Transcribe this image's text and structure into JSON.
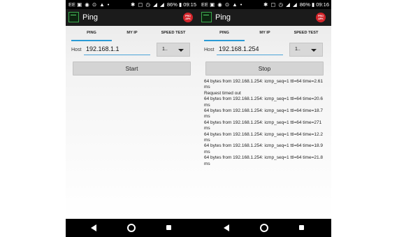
{
  "phones": [
    {
      "status": {
        "carrier": "EE",
        "battery": "86%",
        "time": "09:15"
      },
      "app": {
        "title": "Ping",
        "badge": "PRO APK"
      },
      "tabs": [
        "PING",
        "MY IP",
        "SPEED TEST"
      ],
      "host_label": "Host",
      "host_value": "192.168.1.1",
      "count_value": "1..",
      "action_label": "Start",
      "output": []
    },
    {
      "status": {
        "carrier": "EE",
        "battery": "86%",
        "time": "09:16"
      },
      "app": {
        "title": "Ping",
        "badge": "PRO APK"
      },
      "tabs": [
        "PING",
        "MY IP",
        "SPEED TEST"
      ],
      "host_label": "Host",
      "host_value": "192.168.1.254",
      "count_value": "1..",
      "action_label": "Stop",
      "output": [
        "64 bytes from 192.168.1.254: icmp_seq=1 ttl=64 time=2.61 ms",
        "Request timed out",
        "64 bytes from 192.168.1.254: icmp_seq=1 ttl=64 time=20.6 ms",
        "64 bytes from 192.168.1.254: icmp_seq=1 ttl=64 time=18.7 ms",
        "64 bytes from 192.168.1.254: icmp_seq=1 ttl=64 time=271 ms",
        "64 bytes from 192.168.1.254: icmp_seq=1 ttl=64 time=12.2 ms",
        "64 bytes from 192.168.1.254: icmp_seq=1 ttl=64 time=18.9 ms",
        "64 bytes from 192.168.1.254: icmp_seq=1 ttl=64 time=21.8 ms"
      ]
    }
  ]
}
